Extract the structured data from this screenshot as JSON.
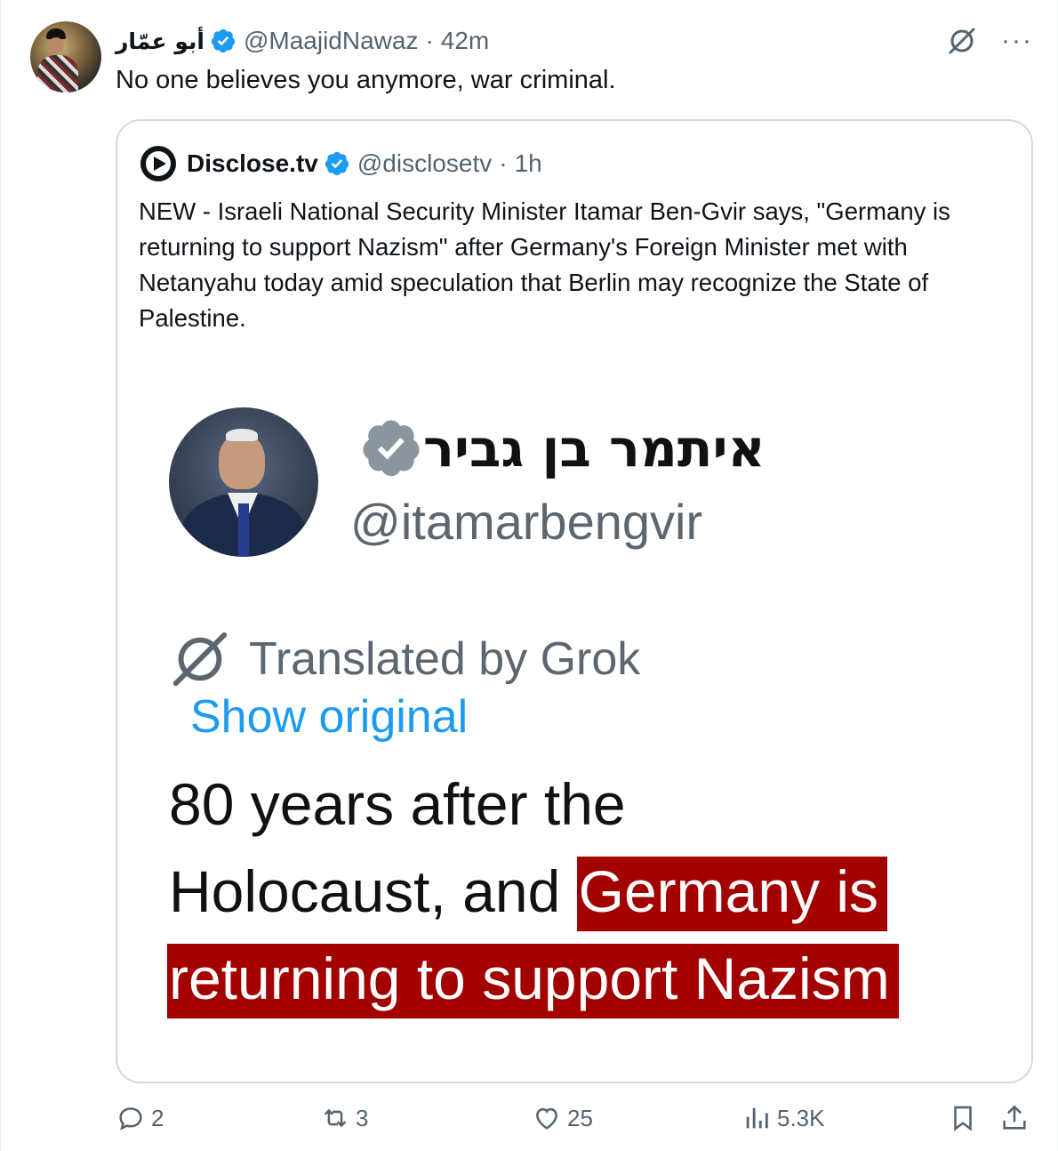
{
  "post": {
    "author_name": "أبو عمّار",
    "handle": "@MaajidNawaz",
    "separator": "·",
    "time": "42m",
    "text": "No one believes you anymore, war criminal."
  },
  "quote": {
    "author_name": "Disclose.tv",
    "handle": "@disclosetv",
    "separator": "·",
    "time": "1h",
    "text": "NEW - Israeli National Security Minister Itamar Ben-Gvir says, \"Germany is returning to support Nazism\" after Germany's Foreign Minister met with Netanyahu today amid speculation that Berlin may recognize the State of Palestine.",
    "screenshot": {
      "name": "איתמר בן גביר",
      "handle": "@itamarbengvir",
      "translated_label": "Translated by Grok",
      "show_original": "Show original",
      "line1": "80 years after the",
      "line2_plain": "Holocaust, and ",
      "line2_highlight": "Germany is",
      "line3_highlight": "returning to support Nazism"
    }
  },
  "actions": {
    "replies": "2",
    "reposts": "3",
    "likes": "25",
    "views": "5.3K"
  },
  "colors": {
    "verified_blue": "#1d9bf0",
    "muted": "#536471",
    "highlight_red": "#a30000",
    "border": "#cfd9de"
  }
}
